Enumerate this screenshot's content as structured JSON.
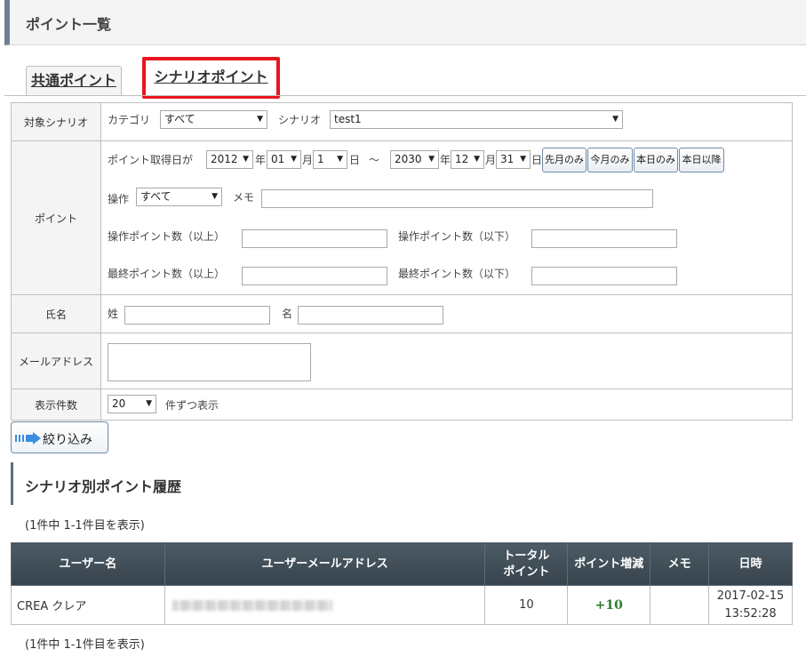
{
  "page": {
    "title": "ポイント一覧"
  },
  "tabs": [
    {
      "label": "共通ポイント"
    },
    {
      "label": "シナリオポイント"
    }
  ],
  "search": {
    "scenario_row": {
      "label": "対象シナリオ",
      "category_label": "カテゴリ",
      "category_value": "すべて",
      "scenario_label": "シナリオ",
      "scenario_value": "test1"
    },
    "point_row": {
      "label": "ポイント",
      "date_label": "ポイント取得日が",
      "from_year": "2012",
      "year_unit": "年",
      "from_month": "01",
      "month_unit": "月",
      "from_day": "1",
      "day_unit": "日",
      "tilde": "～",
      "to_year": "2030",
      "to_month": "12",
      "to_day": "31",
      "buttons": [
        "先月のみ",
        "今月のみ",
        "本日のみ",
        "本日以降"
      ],
      "operation_label": "操作",
      "operation_value": "すべて",
      "memo_label": "メモ",
      "op_min_label": "操作ポイント数（以上）",
      "op_max_label": "操作ポイント数（以下）",
      "final_min_label": "最終ポイント数（以上）",
      "final_max_label": "最終ポイント数（以下）"
    },
    "name_row": {
      "label": "氏名",
      "last_label": "姓",
      "first_label": "名"
    },
    "email_row": {
      "label": "メールアドレス"
    },
    "count_row": {
      "label": "表示件数",
      "value": "20",
      "suffix": "件ずつ表示"
    },
    "filter_button": "絞り込み"
  },
  "results": {
    "section_title": "シナリオ別ポイント履歴",
    "count_text_top": "(1件中 1-1件目を表示)",
    "count_text_bottom": "(1件中 1-1件目を表示)",
    "headers": {
      "user_name": "ユーザー名",
      "email": "ユーザーメールアドレス",
      "total_line1": "トータル",
      "total_line2": "ポイント",
      "delta": "ポイント増減",
      "memo": "メモ",
      "datetime": "日時"
    },
    "rows": [
      {
        "user_name": "CREA クレア",
        "total": "10",
        "delta": "+10",
        "memo": "",
        "date": "2017-02-15",
        "time": "13:52:28"
      }
    ]
  },
  "colors": {
    "accent_red": "#e8161e",
    "positive_green": "#2e7d32",
    "header_dark": "#37434c"
  }
}
